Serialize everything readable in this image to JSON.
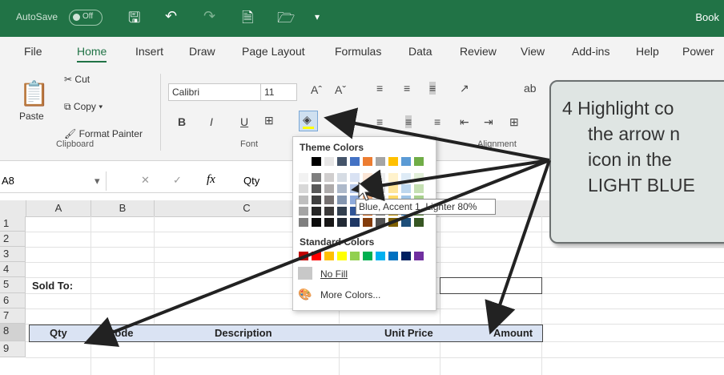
{
  "titlebar": {
    "autosave": "AutoSave",
    "toggle": "Off",
    "book": "Book"
  },
  "tabs": [
    "File",
    "Home",
    "Insert",
    "Draw",
    "Page Layout",
    "Formulas",
    "Data",
    "Review",
    "View",
    "Add-ins",
    "Help",
    "Power"
  ],
  "clipboard": {
    "cut": "Cut",
    "copy": "Copy",
    "paste": "Paste",
    "format_painter": "Format Painter",
    "group": "Clipboard"
  },
  "font": {
    "name": "Calibri",
    "size": "11",
    "group": "Font"
  },
  "alignment": {
    "group": "Alignment"
  },
  "formula_bar": {
    "name_box": "A8",
    "fx": "fx",
    "value": "Qty"
  },
  "columns": [
    "A",
    "B",
    "C"
  ],
  "rows": [
    "1",
    "2",
    "3",
    "4",
    "5",
    "6",
    "7",
    "8",
    "9"
  ],
  "cells": {
    "sold_to": "Sold To:",
    "qty": "Qty",
    "code": "Code",
    "description": "Description",
    "unit_price": "Unit Price",
    "amount": "Amount",
    "colon": ":"
  },
  "dropdown": {
    "theme_colors": "Theme Colors",
    "standard_colors": "Standard Colors",
    "no_fill": "No Fill",
    "more_colors": "More Colors..."
  },
  "tooltip": "Blue, Accent 1, Lighter 80%",
  "callout": {
    "line1": "4  Highlight co",
    "line2": "the arrow n",
    "line3": "icon in the",
    "line4": "LIGHT BLUE"
  },
  "colors": {
    "accent": "#217346",
    "header_fill": "#dae3f3",
    "arrow": "#222222"
  }
}
